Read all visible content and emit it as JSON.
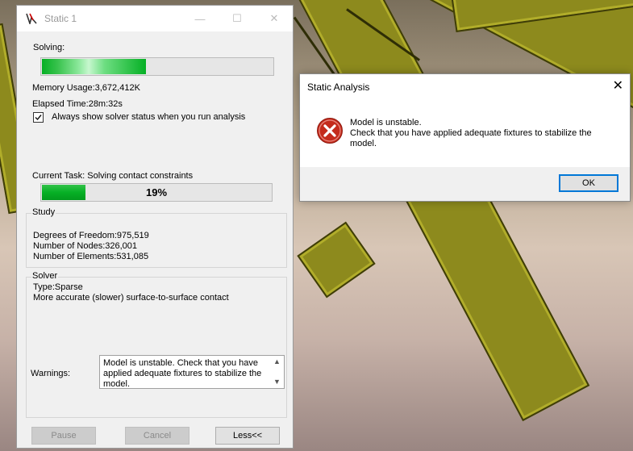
{
  "solver_window": {
    "title": "Static 1",
    "solving_label": "Solving:",
    "solving_progress": 0.45,
    "memory_usage": "Memory Usage:3,672,412K",
    "elapsed_time": "Elapsed Time:28m:32s",
    "always_show_checkbox": {
      "label": "Always show solver status when you run analysis",
      "checked": true
    },
    "current_task": "Current Task: Solving contact constraints",
    "task_progress": {
      "value": 0.19,
      "text": "19%"
    },
    "study": {
      "title": "Study",
      "degrees_of_freedom": "Degrees of Freedom:975,519",
      "nodes": "Number of Nodes:326,001",
      "elements": "Number of Elements:531,085"
    },
    "solver": {
      "title": "Solver",
      "type": "Type:Sparse",
      "contact": "More accurate (slower) surface-to-surface contact",
      "warnings_label": "Warnings:",
      "warnings_text": "Model is unstable. Check that you have applied adequate fixtures to stabilize the model."
    },
    "buttons": {
      "pause": "Pause",
      "cancel": "Cancel",
      "less": "Less<<"
    },
    "controls": {
      "minimize": "—",
      "maximize": "☐",
      "close": "✕"
    }
  },
  "dialog": {
    "title": "Static Analysis",
    "close": "✕",
    "message_line1": "Model is unstable.",
    "message_line2": "Check that you have applied adequate fixtures to stabilize the model.",
    "ok_label": "OK",
    "icon": "error-icon"
  },
  "colors": {
    "progress_green": "#06b025",
    "error_red": "#c42b1c",
    "focus_blue": "#0078d7"
  }
}
